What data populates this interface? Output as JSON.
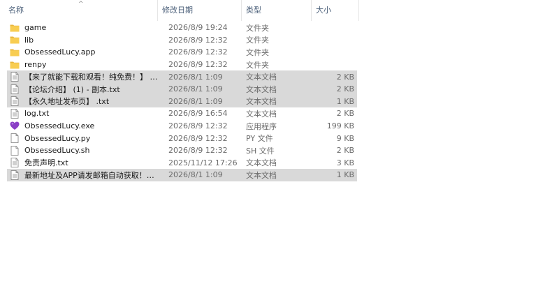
{
  "columns": {
    "name": "名称",
    "date": "修改日期",
    "type": "类型",
    "size": "大小",
    "sort_indicator": "^"
  },
  "colors": {
    "folder": "#f8cd52",
    "folder_dark": "#e8b53c",
    "selection": "#d9d9d9",
    "exe_heart": "#8a3fc6"
  },
  "files": [
    {
      "icon": "folder-icon",
      "name": "game",
      "date": "2026/8/9 19:24",
      "type": "文件夹",
      "size": "",
      "selected": false
    },
    {
      "icon": "folder-icon",
      "name": "lib",
      "date": "2026/8/9 12:32",
      "type": "文件夹",
      "size": "",
      "selected": false
    },
    {
      "icon": "folder-icon",
      "name": "ObsessedLucy.app",
      "date": "2026/8/9 12:32",
      "type": "文件夹",
      "size": "",
      "selected": false
    },
    {
      "icon": "folder-icon",
      "name": "renpy",
      "date": "2026/8/9 12:32",
      "type": "文件夹",
      "size": "",
      "selected": false
    },
    {
      "icon": "text-file-icon",
      "name": "【来了就能下载和观看！纯免费！】 - 副...",
      "date": "2026/8/1 1:09",
      "type": "文本文档",
      "size": "2 KB",
      "selected": true
    },
    {
      "icon": "text-file-icon",
      "name": "【论坛介绍】 (1) - 副本.txt",
      "date": "2026/8/1 1:09",
      "type": "文本文档",
      "size": "2 KB",
      "selected": true
    },
    {
      "icon": "text-file-icon",
      "name": "【永久地址发布页】 .txt",
      "date": "2026/8/1 1:09",
      "type": "文本文档",
      "size": "1 KB",
      "selected": true
    },
    {
      "icon": "text-file-icon",
      "name": "log.txt",
      "date": "2026/8/9 16:54",
      "type": "文本文档",
      "size": "2 KB",
      "selected": false
    },
    {
      "icon": "heart-app-icon",
      "name": "ObsessedLucy.exe",
      "date": "2026/8/9 12:32",
      "type": "应用程序",
      "size": "199 KB",
      "selected": false
    },
    {
      "icon": "blank-file-icon",
      "name": "ObsessedLucy.py",
      "date": "2026/8/9 12:32",
      "type": "PY 文件",
      "size": "9 KB",
      "selected": false
    },
    {
      "icon": "blank-file-icon",
      "name": "ObsessedLucy.sh",
      "date": "2026/8/9 12:32",
      "type": "SH 文件",
      "size": "2 KB",
      "selected": false
    },
    {
      "icon": "text-file-icon",
      "name": "免责声明.txt",
      "date": "2025/11/12 17:26",
      "type": "文本文档",
      "size": "3 KB",
      "selected": false
    },
    {
      "icon": "text-file-icon",
      "name": "最新地址及APP请发邮箱自动获取！！！...",
      "date": "2026/8/1 1:09",
      "type": "文本文档",
      "size": "1 KB",
      "selected": true
    }
  ]
}
